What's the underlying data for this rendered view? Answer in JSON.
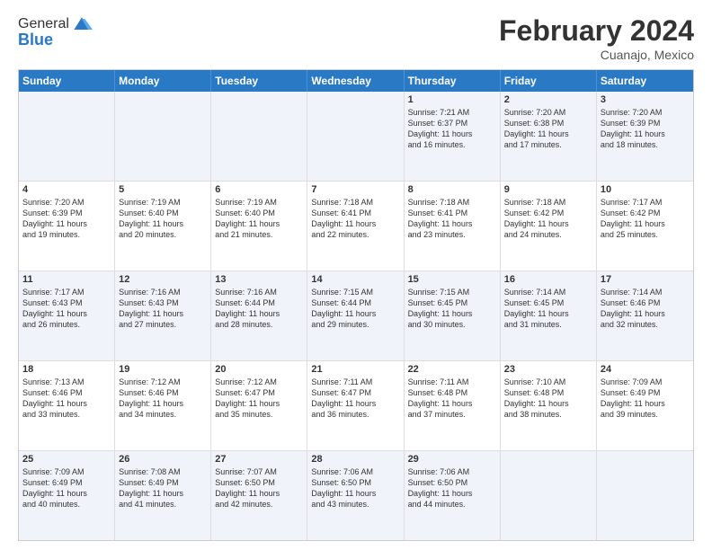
{
  "header": {
    "logo_general": "General",
    "logo_blue": "Blue",
    "month_title": "February 2024",
    "location": "Cuanajo, Mexico"
  },
  "day_headers": [
    "Sunday",
    "Monday",
    "Tuesday",
    "Wednesday",
    "Thursday",
    "Friday",
    "Saturday"
  ],
  "rows": [
    [
      {
        "num": "",
        "info": ""
      },
      {
        "num": "",
        "info": ""
      },
      {
        "num": "",
        "info": ""
      },
      {
        "num": "",
        "info": ""
      },
      {
        "num": "1",
        "info": "Sunrise: 7:21 AM\nSunset: 6:37 PM\nDaylight: 11 hours\nand 16 minutes."
      },
      {
        "num": "2",
        "info": "Sunrise: 7:20 AM\nSunset: 6:38 PM\nDaylight: 11 hours\nand 17 minutes."
      },
      {
        "num": "3",
        "info": "Sunrise: 7:20 AM\nSunset: 6:39 PM\nDaylight: 11 hours\nand 18 minutes."
      }
    ],
    [
      {
        "num": "4",
        "info": "Sunrise: 7:20 AM\nSunset: 6:39 PM\nDaylight: 11 hours\nand 19 minutes."
      },
      {
        "num": "5",
        "info": "Sunrise: 7:19 AM\nSunset: 6:40 PM\nDaylight: 11 hours\nand 20 minutes."
      },
      {
        "num": "6",
        "info": "Sunrise: 7:19 AM\nSunset: 6:40 PM\nDaylight: 11 hours\nand 21 minutes."
      },
      {
        "num": "7",
        "info": "Sunrise: 7:18 AM\nSunset: 6:41 PM\nDaylight: 11 hours\nand 22 minutes."
      },
      {
        "num": "8",
        "info": "Sunrise: 7:18 AM\nSunset: 6:41 PM\nDaylight: 11 hours\nand 23 minutes."
      },
      {
        "num": "9",
        "info": "Sunrise: 7:18 AM\nSunset: 6:42 PM\nDaylight: 11 hours\nand 24 minutes."
      },
      {
        "num": "10",
        "info": "Sunrise: 7:17 AM\nSunset: 6:42 PM\nDaylight: 11 hours\nand 25 minutes."
      }
    ],
    [
      {
        "num": "11",
        "info": "Sunrise: 7:17 AM\nSunset: 6:43 PM\nDaylight: 11 hours\nand 26 minutes."
      },
      {
        "num": "12",
        "info": "Sunrise: 7:16 AM\nSunset: 6:43 PM\nDaylight: 11 hours\nand 27 minutes."
      },
      {
        "num": "13",
        "info": "Sunrise: 7:16 AM\nSunset: 6:44 PM\nDaylight: 11 hours\nand 28 minutes."
      },
      {
        "num": "14",
        "info": "Sunrise: 7:15 AM\nSunset: 6:44 PM\nDaylight: 11 hours\nand 29 minutes."
      },
      {
        "num": "15",
        "info": "Sunrise: 7:15 AM\nSunset: 6:45 PM\nDaylight: 11 hours\nand 30 minutes."
      },
      {
        "num": "16",
        "info": "Sunrise: 7:14 AM\nSunset: 6:45 PM\nDaylight: 11 hours\nand 31 minutes."
      },
      {
        "num": "17",
        "info": "Sunrise: 7:14 AM\nSunset: 6:46 PM\nDaylight: 11 hours\nand 32 minutes."
      }
    ],
    [
      {
        "num": "18",
        "info": "Sunrise: 7:13 AM\nSunset: 6:46 PM\nDaylight: 11 hours\nand 33 minutes."
      },
      {
        "num": "19",
        "info": "Sunrise: 7:12 AM\nSunset: 6:46 PM\nDaylight: 11 hours\nand 34 minutes."
      },
      {
        "num": "20",
        "info": "Sunrise: 7:12 AM\nSunset: 6:47 PM\nDaylight: 11 hours\nand 35 minutes."
      },
      {
        "num": "21",
        "info": "Sunrise: 7:11 AM\nSunset: 6:47 PM\nDaylight: 11 hours\nand 36 minutes."
      },
      {
        "num": "22",
        "info": "Sunrise: 7:11 AM\nSunset: 6:48 PM\nDaylight: 11 hours\nand 37 minutes."
      },
      {
        "num": "23",
        "info": "Sunrise: 7:10 AM\nSunset: 6:48 PM\nDaylight: 11 hours\nand 38 minutes."
      },
      {
        "num": "24",
        "info": "Sunrise: 7:09 AM\nSunset: 6:49 PM\nDaylight: 11 hours\nand 39 minutes."
      }
    ],
    [
      {
        "num": "25",
        "info": "Sunrise: 7:09 AM\nSunset: 6:49 PM\nDaylight: 11 hours\nand 40 minutes."
      },
      {
        "num": "26",
        "info": "Sunrise: 7:08 AM\nSunset: 6:49 PM\nDaylight: 11 hours\nand 41 minutes."
      },
      {
        "num": "27",
        "info": "Sunrise: 7:07 AM\nSunset: 6:50 PM\nDaylight: 11 hours\nand 42 minutes."
      },
      {
        "num": "28",
        "info": "Sunrise: 7:06 AM\nSunset: 6:50 PM\nDaylight: 11 hours\nand 43 minutes."
      },
      {
        "num": "29",
        "info": "Sunrise: 7:06 AM\nSunset: 6:50 PM\nDaylight: 11 hours\nand 44 minutes."
      },
      {
        "num": "",
        "info": ""
      },
      {
        "num": "",
        "info": ""
      }
    ]
  ],
  "alt_rows": [
    0,
    2,
    4
  ]
}
